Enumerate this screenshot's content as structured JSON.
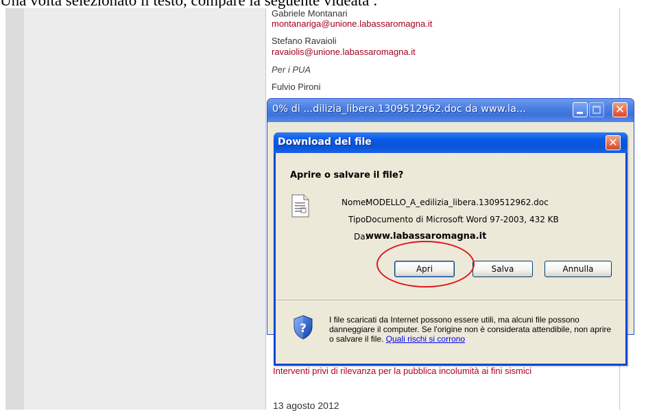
{
  "caption": "Una volta selezionato il testo, compare la seguente videata :",
  "background_page": {
    "lines": [
      {
        "text": "Gabriele Montanari",
        "style": "name"
      },
      {
        "text": "montanariga@unione.labassaromagna.it",
        "style": "mail"
      },
      {
        "text": "Stefano Ravaioli",
        "style": "name"
      },
      {
        "text": "ravaiolis@unione.labassaromagna.it",
        "style": "mail"
      },
      {
        "text": "Per i PUA",
        "style": "italic"
      },
      {
        "text": "Fulvio Pironi",
        "style": "name"
      }
    ],
    "bottom_link": "Interventi privi di rilevanza per la pubblica incolumità ai fini sismici",
    "date": "13 agosto 2012"
  },
  "progress_window": {
    "title": "0% di ...dilizia_libera.1309512962.doc da www.la..."
  },
  "download_dialog": {
    "title": "Download del file",
    "question": "Aprire o salvare il file?",
    "name_label": "Nome:",
    "name_value": "MODELLO_A_edilizia_libera.1309512962.doc",
    "type_label": "Tipo:",
    "type_value": "Documento di Microsoft Word 97-2003, 432 KB",
    "from_label": "Da:",
    "from_value": "www.labassaromagna.it",
    "buttons": {
      "open": "Apri",
      "save": "Salva",
      "cancel": "Annulla"
    },
    "warning_text": "I file scaricati da Internet possono essere utili, ma alcuni file possono danneggiare il computer. Se l'origine non è considerata attendibile, non aprire o salvare il file.",
    "warning_link": "Quali rischi si corrono"
  },
  "icons": {
    "document": "word-document-icon",
    "security": "shield-question-icon"
  },
  "colors": {
    "title_blue": "#0a5ae6",
    "annotation_red": "#e0141e",
    "email_red": "#a0001a"
  }
}
